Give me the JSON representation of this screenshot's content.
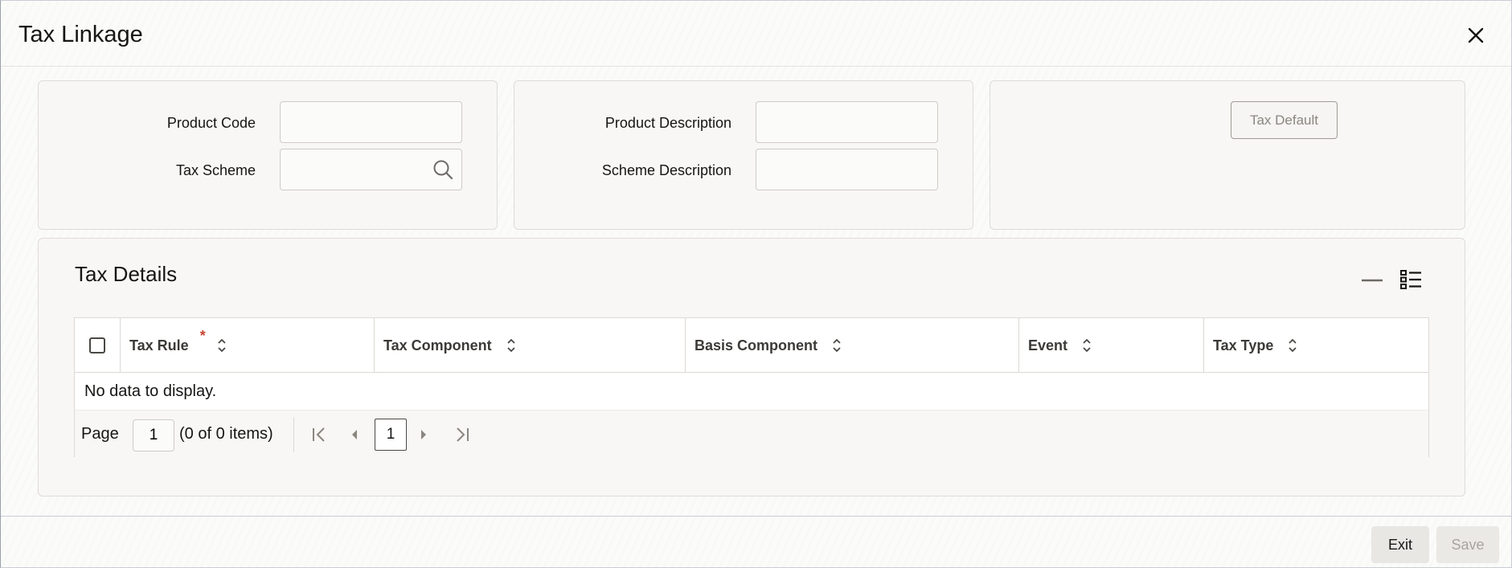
{
  "window": {
    "title": "Tax Linkage",
    "close_icon": "close-icon"
  },
  "form": {
    "product_code_label": "Product Code",
    "product_code_value": "",
    "tax_scheme_label": "Tax Scheme",
    "tax_scheme_value": "",
    "product_description_label": "Product Description",
    "product_description_value": "",
    "scheme_description_label": "Scheme Description",
    "scheme_description_value": "",
    "tax_default_label": "Tax Default"
  },
  "tax_details": {
    "title": "Tax Details",
    "columns": [
      {
        "label": "Tax Rule",
        "required": true
      },
      {
        "label": "Tax Component",
        "required": false
      },
      {
        "label": "Basis Component",
        "required": false
      },
      {
        "label": "Event",
        "required": false
      },
      {
        "label": "Tax Type",
        "required": false
      }
    ],
    "required_marker": "*",
    "empty_text": "No data to display.",
    "pager": {
      "page_label": "Page",
      "page_value": "1",
      "range_text": "(0 of 0 items)",
      "current_page": "1"
    }
  },
  "footer": {
    "exit_label": "Exit",
    "save_label": "Save"
  },
  "colors": {
    "required": "#c74634",
    "panel_bg": "#f8f7f5",
    "border": "#dcd9d4"
  }
}
